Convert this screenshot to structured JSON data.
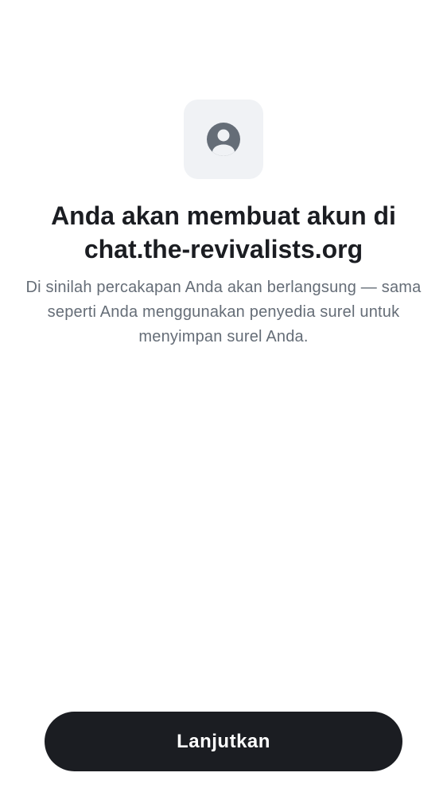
{
  "header": {
    "icon": "user-profile-icon",
    "title": "Anda akan membuat akun di chat.the-revivalists.org",
    "description": "Di sinilah percakapan Anda akan berlangsung — sama seperti Anda menggunakan penyedia surel untuk menyimpan surel Anda."
  },
  "actions": {
    "continue_label": "Lanjutkan"
  },
  "colors": {
    "background": "#ffffff",
    "icon_tile": "#f0f2f5",
    "icon": "#656d77",
    "title": "#1b1d22",
    "body_text": "#656d77",
    "button_bg": "#1b1d22",
    "button_text": "#ffffff"
  }
}
